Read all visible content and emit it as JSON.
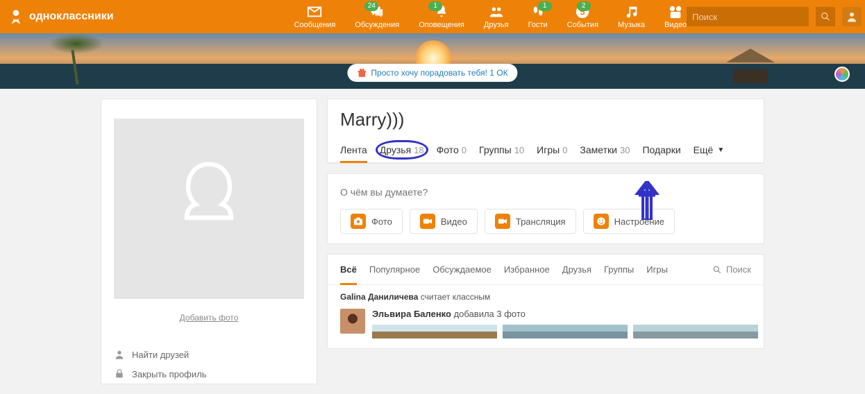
{
  "brand": "одноклассники",
  "topnav": {
    "messages": {
      "label": "Сообщения"
    },
    "discussions": {
      "label": "Обсуждения",
      "badge": "24"
    },
    "notifications": {
      "label": "Оповещения",
      "badge": "1"
    },
    "friends": {
      "label": "Друзья"
    },
    "guests": {
      "label": "Гости",
      "badge": "1"
    },
    "events": {
      "label": "События",
      "badge": "2"
    },
    "music": {
      "label": "Музыка"
    },
    "video": {
      "label": "Видео"
    }
  },
  "search": {
    "placeholder": "Поиск"
  },
  "cover": {
    "promo": "Просто хочу порадовать тебя! 1 ОК"
  },
  "profile": {
    "name": "Marry)))",
    "add_photo": "Добавить фото",
    "tabs": {
      "feed": {
        "label": "Лента"
      },
      "friends": {
        "label": "Друзья",
        "count": "18"
      },
      "photos": {
        "label": "Фото",
        "count": "0"
      },
      "groups": {
        "label": "Группы",
        "count": "10"
      },
      "games": {
        "label": "Игры",
        "count": "0"
      },
      "notes": {
        "label": "Заметки",
        "count": "30"
      },
      "gifts": {
        "label": "Подарки"
      },
      "more": {
        "label": "Ещё"
      }
    }
  },
  "composer": {
    "placeholder": "О чём вы думаете?",
    "photo": "Фото",
    "video": "Видео",
    "stream": "Трансляция",
    "mood": "Настроение"
  },
  "feed": {
    "tabs": {
      "all": "Всё",
      "popular": "Популярное",
      "discussed": "Обсуждаемое",
      "fav": "Избранное",
      "friends": "Друзья",
      "groups": "Группы",
      "games": "Игры"
    },
    "search": "Поиск",
    "credit_name": "Galina Даниличева",
    "credit_action": "считает классным",
    "post_name": "Эльвира Баленко",
    "post_action": "добавила 3 фото"
  },
  "side_links": {
    "find": "Найти друзей",
    "lock": "Закрыть профиль"
  }
}
